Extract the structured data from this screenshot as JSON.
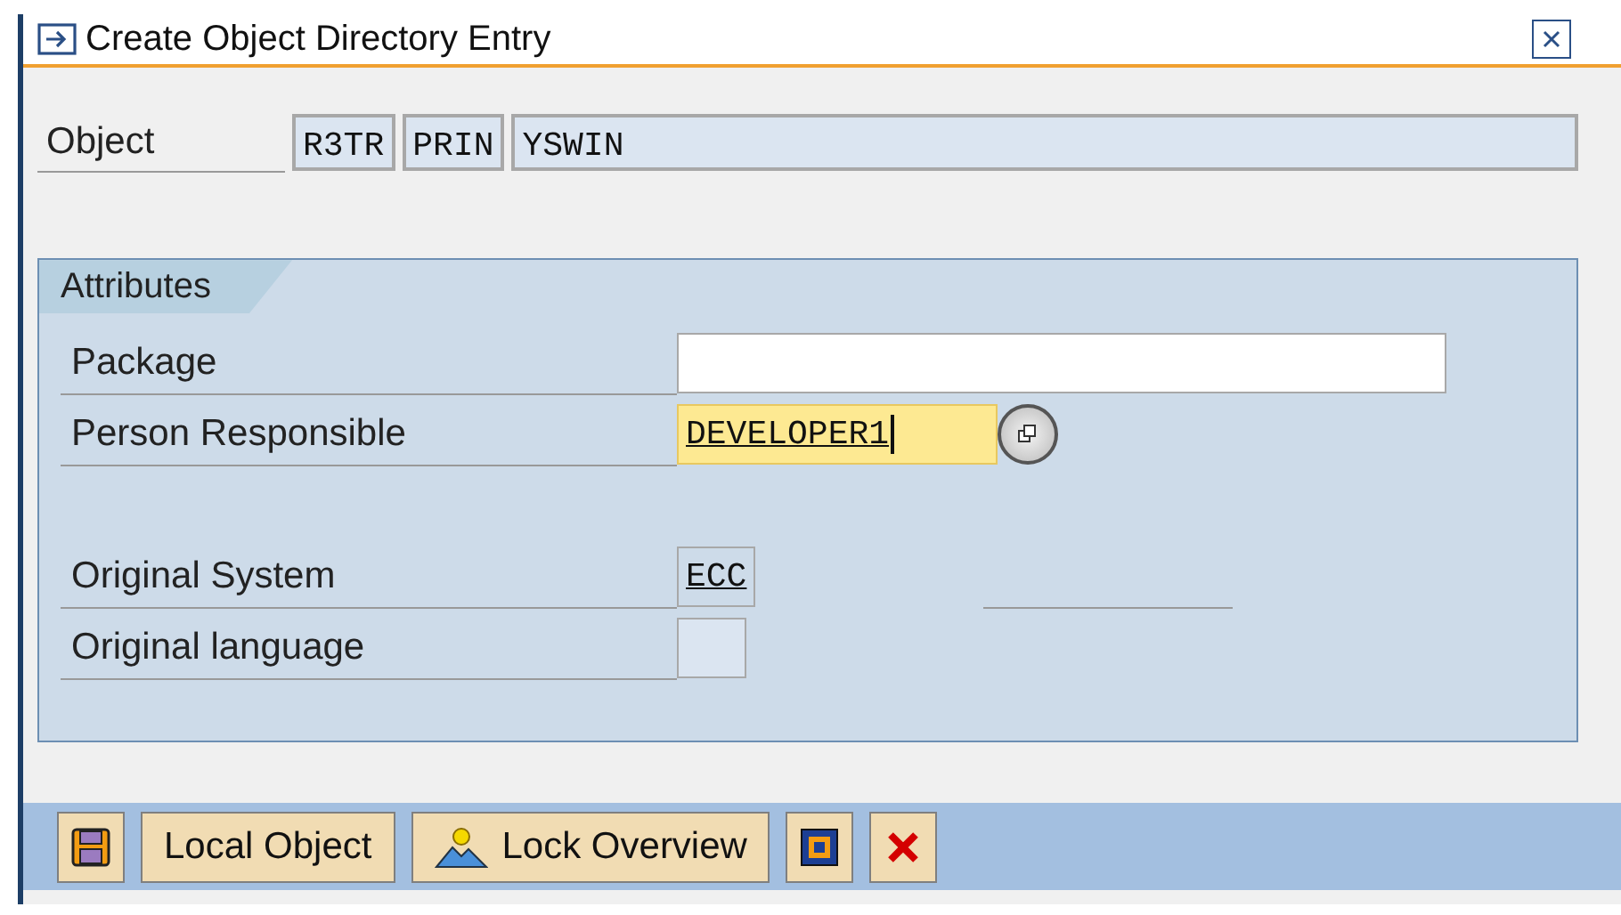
{
  "window": {
    "title": "Create Object Directory Entry"
  },
  "object": {
    "label": "Object",
    "fields": [
      "R3TR",
      "PRIN",
      "YSWIN"
    ]
  },
  "attributes": {
    "tab": "Attributes",
    "rows": [
      {
        "label": "Package",
        "kind": "text-field",
        "focused": false
      },
      {
        "label": "Person Responsible",
        "kind": "help-field",
        "value": "DEVELOPER1",
        "focused": true
      },
      {
        "label": "Original System",
        "kind": "display-field",
        "value": "ECC"
      },
      {
        "label": "Original language",
        "kind": "short-field",
        "focused": false
      }
    ]
  },
  "toolbar": [
    {
      "kind": "save"
    },
    {
      "kind": "text",
      "label": "Local Object"
    },
    {
      "kind": "lock",
      "label": "Lock Overview"
    },
    {
      "kind": "jump"
    },
    {
      "kind": "cancel"
    }
  ]
}
